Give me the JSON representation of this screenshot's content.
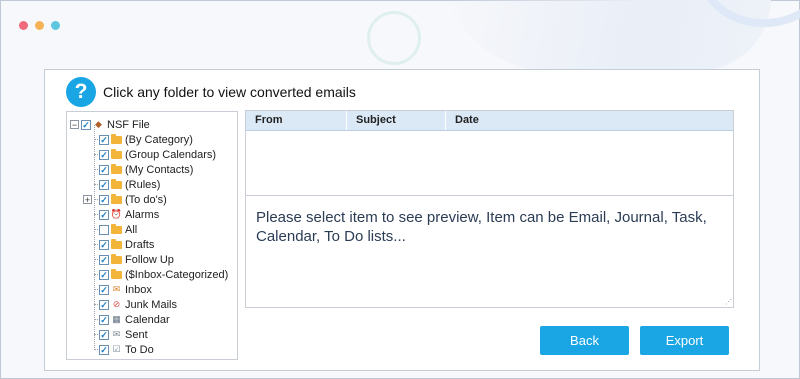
{
  "window": {
    "controls": [
      {
        "name": "close",
        "color": "#ef6b7c"
      },
      {
        "name": "minimize",
        "color": "#f6b356"
      },
      {
        "name": "maximize",
        "color": "#5fc6e0"
      }
    ]
  },
  "dialog": {
    "help_icon": "?",
    "title": "Click any folder to view converted emails"
  },
  "tree": {
    "root": {
      "label": "NSF File",
      "checked": true,
      "expanded": true,
      "icon": "nsf-file-icon"
    },
    "items": [
      {
        "label": "(By Category)",
        "checked": true,
        "icon": "folder-icon"
      },
      {
        "label": "(Group Calendars)",
        "checked": true,
        "icon": "folder-icon"
      },
      {
        "label": "(My Contacts)",
        "checked": true,
        "icon": "folder-icon"
      },
      {
        "label": "(Rules)",
        "checked": true,
        "icon": "folder-icon"
      },
      {
        "label": "(To do's)",
        "checked": true,
        "icon": "folder-icon",
        "expandable": true
      },
      {
        "label": "Alarms",
        "checked": true,
        "icon": "alarm-clock-icon"
      },
      {
        "label": "All",
        "checked": false,
        "icon": "folder-icon"
      },
      {
        "label": "Drafts",
        "checked": true,
        "icon": "folder-icon"
      },
      {
        "label": "Follow Up",
        "checked": true,
        "icon": "folder-icon"
      },
      {
        "label": "($Inbox-Categorized)",
        "checked": true,
        "icon": "folder-icon"
      },
      {
        "label": "Inbox",
        "checked": true,
        "icon": "inbox-icon"
      },
      {
        "label": "Junk Mails",
        "checked": true,
        "icon": "junk-mail-icon"
      },
      {
        "label": "Calendar",
        "checked": true,
        "icon": "calendar-icon"
      },
      {
        "label": "Sent",
        "checked": true,
        "icon": "sent-icon"
      },
      {
        "label": "To Do",
        "checked": true,
        "icon": "todo-icon"
      }
    ]
  },
  "grid": {
    "columns": [
      "From",
      "Subject",
      "Date"
    ],
    "rows": []
  },
  "preview": {
    "message": "Please select item to see preview, Item can be Email, Journal, Task, Calendar, To Do lists..."
  },
  "buttons": {
    "back": "Back",
    "export": "Export"
  },
  "colors": {
    "accent": "#1aa6e4",
    "grid_header": "#dbe9f7"
  }
}
